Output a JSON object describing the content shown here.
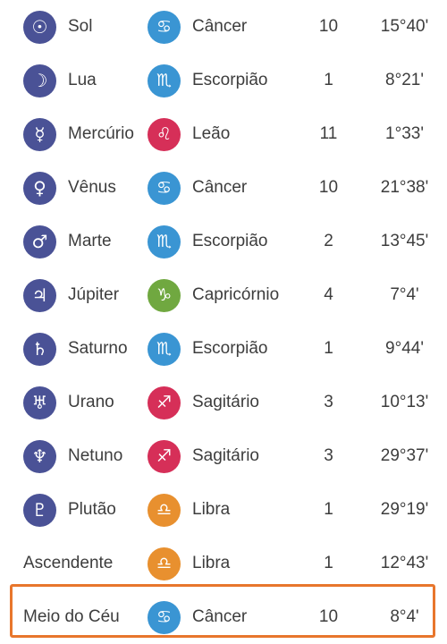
{
  "table": {
    "element_colors": {
      "planet": "#4a5296",
      "water": "#3a95d3",
      "fire": "#d62f58",
      "earth": "#70a840",
      "air": "#e8902f"
    },
    "highlight_color": "#e8762c",
    "highlighted_row_index": 11,
    "rows": [
      {
        "planet": "Sol",
        "planet_icon": "sun-icon",
        "planet_glyph": "☉",
        "sign": "Câncer",
        "sign_icon": "cancer-icon",
        "sign_glyph": "♋",
        "sign_element": "water",
        "house": "10",
        "degree": "15°40'"
      },
      {
        "planet": "Lua",
        "planet_icon": "moon-icon",
        "planet_glyph": "☽",
        "sign": "Escorpião",
        "sign_icon": "scorpio-icon",
        "sign_glyph": "♏",
        "sign_element": "water",
        "house": "1",
        "degree": "8°21'"
      },
      {
        "planet": "Mercúrio",
        "planet_icon": "mercury-icon",
        "planet_glyph": "☿",
        "sign": "Leão",
        "sign_icon": "leo-icon",
        "sign_glyph": "♌",
        "sign_element": "fire",
        "house": "11",
        "degree": "1°33'"
      },
      {
        "planet": "Vênus",
        "planet_icon": "venus-icon",
        "planet_glyph": "♀",
        "sign": "Câncer",
        "sign_icon": "cancer-icon",
        "sign_glyph": "♋",
        "sign_element": "water",
        "house": "10",
        "degree": "21°38'"
      },
      {
        "planet": "Marte",
        "planet_icon": "mars-icon",
        "planet_glyph": "♂",
        "sign": "Escorpião",
        "sign_icon": "scorpio-icon",
        "sign_glyph": "♏",
        "sign_element": "water",
        "house": "2",
        "degree": "13°45'"
      },
      {
        "planet": "Júpiter",
        "planet_icon": "jupiter-icon",
        "planet_glyph": "♃",
        "sign": "Capricórnio",
        "sign_icon": "capricorn-icon",
        "sign_glyph": "♑",
        "sign_element": "earth",
        "house": "4",
        "degree": "7°4'"
      },
      {
        "planet": "Saturno",
        "planet_icon": "saturn-icon",
        "planet_glyph": "♄",
        "sign": "Escorpião",
        "sign_icon": "scorpio-icon",
        "sign_glyph": "♏",
        "sign_element": "water",
        "house": "1",
        "degree": "9°44'"
      },
      {
        "planet": "Urano",
        "planet_icon": "uranus-icon",
        "planet_glyph": "♅",
        "sign": "Sagitário",
        "sign_icon": "sagittarius-icon",
        "sign_glyph": "♐",
        "sign_element": "fire",
        "house": "3",
        "degree": "10°13'"
      },
      {
        "planet": "Netuno",
        "planet_icon": "neptune-icon",
        "planet_glyph": "♆",
        "sign": "Sagitário",
        "sign_icon": "sagittarius-icon",
        "sign_glyph": "♐",
        "sign_element": "fire",
        "house": "3",
        "degree": "29°37'"
      },
      {
        "planet": "Plutão",
        "planet_icon": "pluto-icon",
        "planet_glyph": "♇",
        "sign": "Libra",
        "sign_icon": "libra-icon",
        "sign_glyph": "♎",
        "sign_element": "air",
        "house": "1",
        "degree": "29°19'"
      },
      {
        "planet": "Ascendente",
        "planet_icon": "",
        "planet_glyph": "",
        "sign": "Libra",
        "sign_icon": "libra-icon",
        "sign_glyph": "♎",
        "sign_element": "air",
        "house": "1",
        "degree": "12°43'"
      },
      {
        "planet": "Meio do Céu",
        "planet_icon": "",
        "planet_glyph": "",
        "sign": "Câncer",
        "sign_icon": "cancer-icon",
        "sign_glyph": "♋",
        "sign_element": "water",
        "house": "10",
        "degree": "8°4'"
      }
    ]
  }
}
